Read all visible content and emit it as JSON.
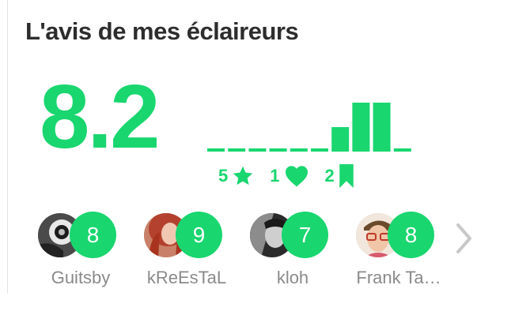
{
  "title": "L'avis de mes éclaireurs",
  "score": "8.2",
  "colors": {
    "accent": "#19d66f",
    "text": "#2d2d2d",
    "muted": "#8a8a8a",
    "arrow": "#c8c8c8"
  },
  "histogram": {
    "grades": [
      1,
      2,
      3,
      4,
      5,
      6,
      7,
      8,
      9,
      10
    ],
    "counts": [
      0,
      0,
      0,
      0,
      0,
      0,
      1,
      2,
      2,
      0
    ]
  },
  "stats": [
    {
      "value": "5",
      "icon": "star-icon"
    },
    {
      "value": "1",
      "icon": "heart-icon"
    },
    {
      "value": "2",
      "icon": "bookmark-icon"
    }
  ],
  "scouts": [
    {
      "name": "Guitsby",
      "grade": "8",
      "avatar": "avatar-dark"
    },
    {
      "name": "kReEsTaL",
      "grade": "9",
      "avatar": "avatar-redhead"
    },
    {
      "name": "kloh",
      "grade": "7",
      "avatar": "avatar-bw"
    },
    {
      "name": "Frank Ta…",
      "grade": "8",
      "avatar": "avatar-glasses"
    }
  ],
  "next_icon": "chevron-right-icon"
}
